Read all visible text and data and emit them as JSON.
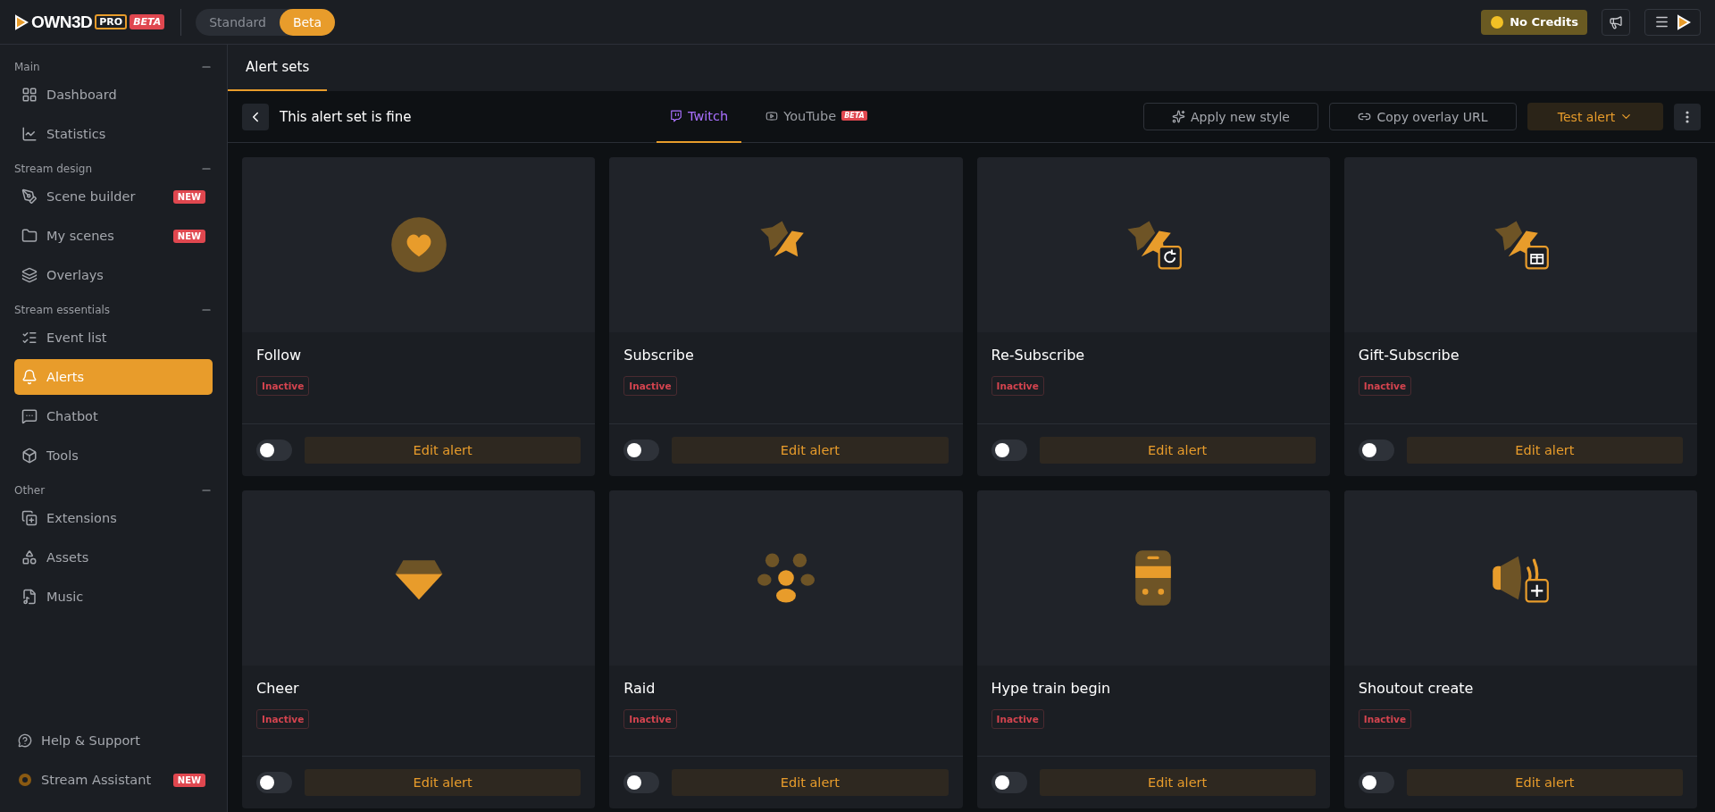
{
  "header": {
    "logo": {
      "brand": "OWN3D",
      "tier": "PRO",
      "stage": "BETA"
    },
    "mode_switch": [
      {
        "label": "Standard",
        "selected": false
      },
      {
        "label": "Beta",
        "selected": true
      }
    ],
    "credits": "No Credits"
  },
  "sidebar": {
    "sections": [
      {
        "title": "Main",
        "items": [
          {
            "label": "Dashboard",
            "selected": false
          },
          {
            "label": "Statistics",
            "selected": false
          }
        ]
      },
      {
        "title": "Stream design",
        "items": [
          {
            "label": "Scene builder",
            "badge": "NEW",
            "selected": false
          },
          {
            "label": "My scenes",
            "badge": "NEW",
            "selected": false
          },
          {
            "label": "Overlays",
            "selected": false
          }
        ]
      },
      {
        "title": "Stream essentials",
        "items": [
          {
            "label": "Event list",
            "selected": false
          },
          {
            "label": "Alerts",
            "selected": true
          },
          {
            "label": "Chatbot",
            "selected": false
          },
          {
            "label": "Tools",
            "selected": false
          }
        ]
      },
      {
        "title": "Other",
        "items": [
          {
            "label": "Extensions",
            "selected": false
          },
          {
            "label": "Assets",
            "selected": false
          },
          {
            "label": "Music",
            "selected": false
          }
        ]
      }
    ],
    "footer": [
      {
        "label": "Help & Support"
      },
      {
        "label": "Stream Assistant",
        "badge": "NEW"
      }
    ]
  },
  "tabs": [
    {
      "label": "Alert sets",
      "selected": true
    }
  ],
  "toolbar": {
    "title": "This alert set is fine",
    "platforms": [
      {
        "label": "Twitch",
        "selected": true
      },
      {
        "label": "YouTube",
        "badge": "BETA",
        "selected": false
      }
    ],
    "actions": [
      "Apply new style",
      "Copy overlay URL"
    ],
    "test_button": "Test alert"
  },
  "alerts": [
    {
      "name": "Follow",
      "status": "Inactive",
      "enabled": false,
      "button": "Edit alert"
    },
    {
      "name": "Subscribe",
      "status": "Inactive",
      "enabled": false,
      "button": "Edit alert"
    },
    {
      "name": "Re-Subscribe",
      "status": "Inactive",
      "enabled": false,
      "button": "Edit alert"
    },
    {
      "name": "Gift-Subscribe",
      "status": "Inactive",
      "enabled": false,
      "button": "Edit alert"
    },
    {
      "name": "Cheer",
      "status": "Inactive",
      "enabled": false,
      "button": "Edit alert"
    },
    {
      "name": "Raid",
      "status": "Inactive",
      "enabled": false,
      "button": "Edit alert"
    },
    {
      "name": "Hype train begin",
      "status": "Inactive",
      "enabled": false,
      "button": "Edit alert"
    },
    {
      "name": "Shoutout create",
      "status": "Inactive",
      "enabled": false,
      "button": "Edit alert"
    }
  ]
}
